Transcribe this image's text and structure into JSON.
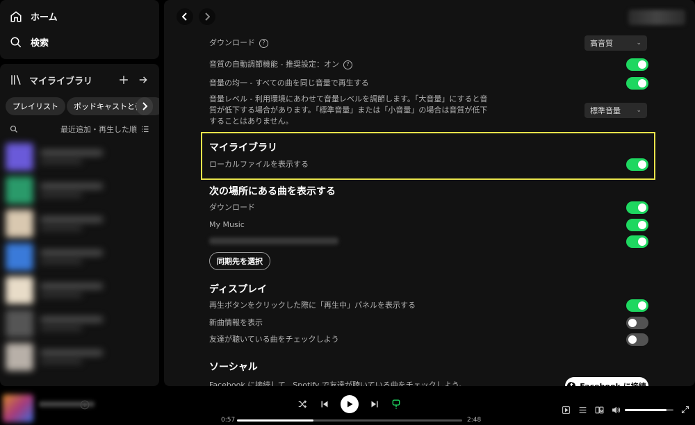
{
  "nav": {
    "home_label": "ホーム",
    "search_label": "検索"
  },
  "library": {
    "title": "マイライブラリ",
    "chips": [
      "プレイリスト",
      "ポッドキャストと番"
    ],
    "sort_label": "最近追加・再生した順"
  },
  "settings": {
    "download_label": "ダウンロード",
    "download_quality_value": "高音質",
    "auto_adjust_label": "音質の自動調節機能 - 推奨設定：オン",
    "auto_adjust_on": true,
    "normalize_label": "音量の均一 - すべての曲を同じ音量で再生する",
    "normalize_on": true,
    "volume_level_label": "音量レベル - 利用環境にあわせて音量レベルを調節します。「大音量」にすると音質が低下する場合があります。「標準音量」または「小音量」の場合は音質が低下することはありません。",
    "volume_level_value": "標準音量",
    "my_library_title": "マイライブラリ",
    "local_files_label": "ローカルファイルを表示する",
    "local_files_on": true,
    "show_songs_title": "次の場所にある曲を表示する",
    "source_download_label": "ダウンロード",
    "source_download_on": true,
    "source_mymusic_label": "My Music",
    "source_mymusic_on": true,
    "source_other_on": true,
    "sync_button_label": "同期先を選択",
    "display_title": "ディスプレイ",
    "now_playing_label": "再生ボタンをクリックした際に「再生中」パネルを表示する",
    "now_playing_on": true,
    "new_releases_label": "新曲情報を表示",
    "new_releases_on": false,
    "friends_label": "友達が聴いている曲をチェックしよう",
    "friends_on": false,
    "social_title": "ソーシャル",
    "facebook_label": "Facebook に接続して、Spotify で友達が聴いている曲をチェックしよう。",
    "facebook_button_label": "Facebook に接続"
  },
  "player": {
    "elapsed": "0:57",
    "duration": "2:48",
    "progress": 0.34,
    "volume": 0.85
  },
  "colors": {
    "accent": "#1ed760",
    "highlight_border": "#e8e34a",
    "panel": "#121212"
  }
}
